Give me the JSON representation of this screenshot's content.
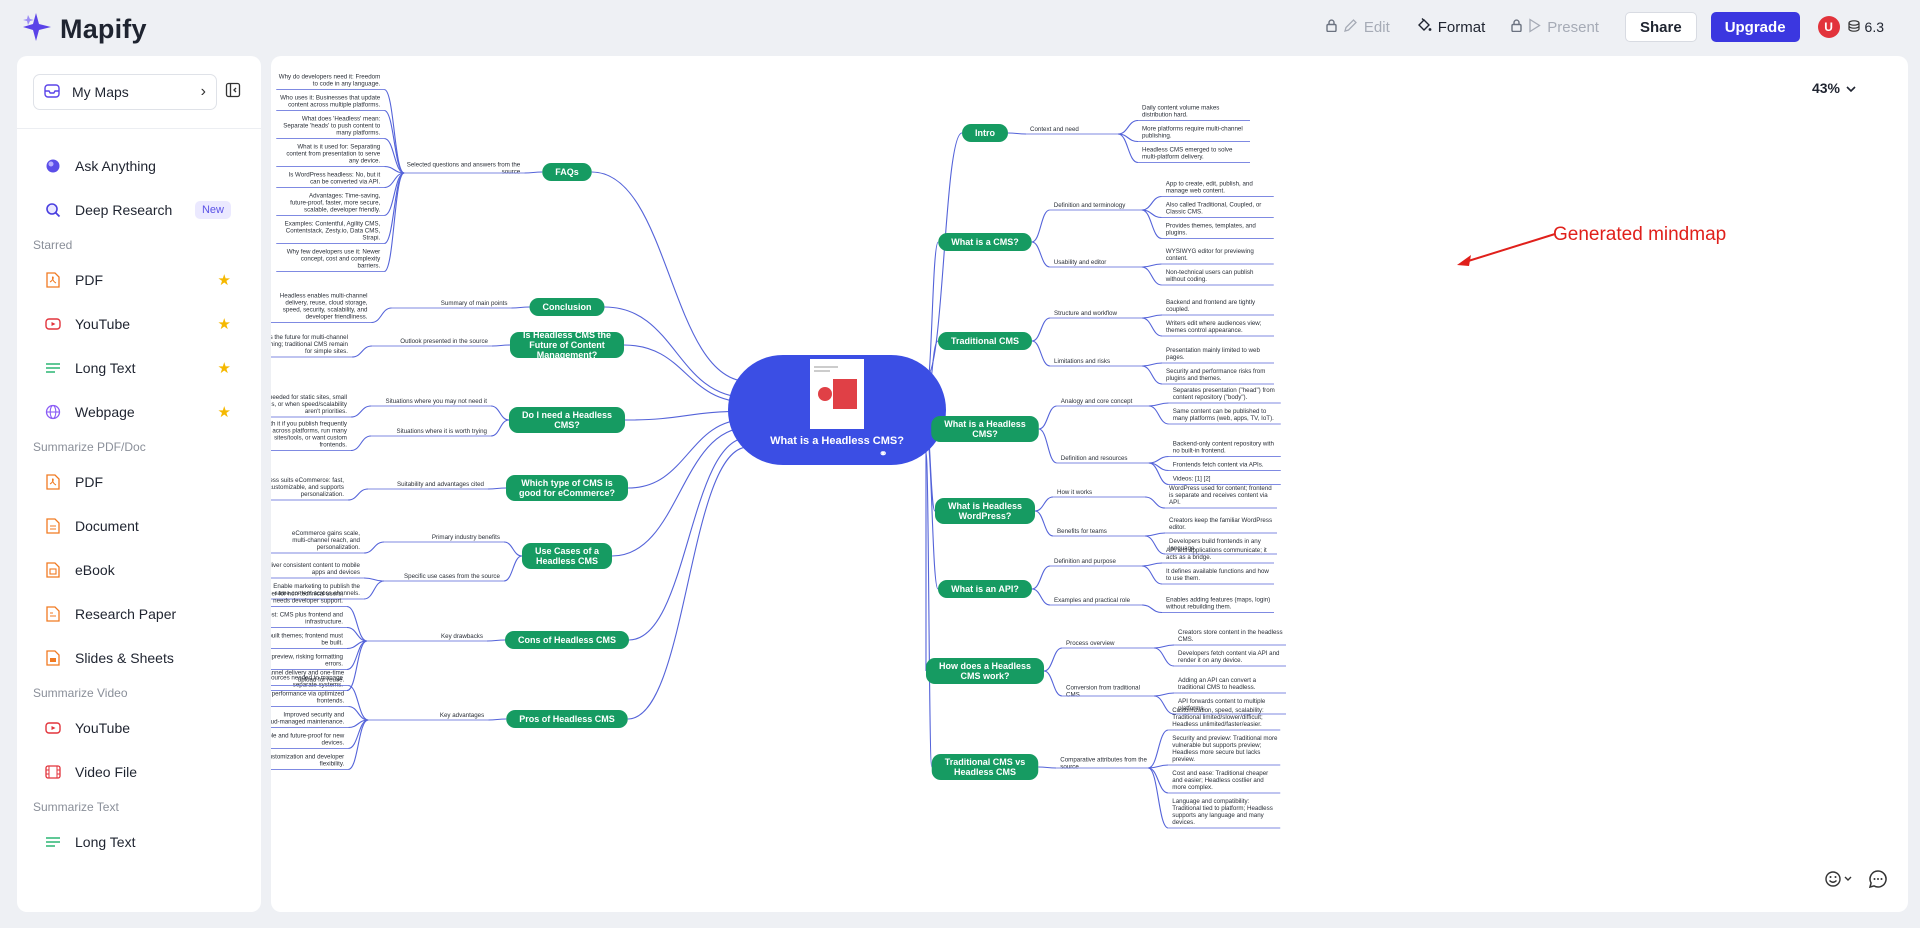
{
  "app": {
    "name": "Mapify"
  },
  "toolbar": {
    "edit": "Edit",
    "format": "Format",
    "present": "Present",
    "share": "Share",
    "upgrade": "Upgrade",
    "avatar": "U",
    "credits": "6.3"
  },
  "sidebar": {
    "my_maps": "My Maps",
    "items": [
      {
        "label": "Ask Anything",
        "icon": "orb-icon"
      },
      {
        "label": "Deep Research",
        "icon": "search-icon",
        "badge": "New"
      }
    ],
    "starred_head": "Starred",
    "starred": [
      {
        "label": "PDF",
        "icon": "pdf-icon"
      },
      {
        "label": "YouTube",
        "icon": "youtube-icon"
      },
      {
        "label": "Long Text",
        "icon": "long-text-icon"
      },
      {
        "label": "Webpage",
        "icon": "globe-icon"
      }
    ],
    "pdf_head": "Summarize PDF/Doc",
    "pdf": [
      {
        "label": "PDF",
        "icon": "pdf-icon"
      },
      {
        "label": "Document",
        "icon": "document-icon"
      },
      {
        "label": "eBook",
        "icon": "ebook-icon"
      },
      {
        "label": "Research Paper",
        "icon": "paper-icon"
      },
      {
        "label": "Slides & Sheets",
        "icon": "slides-icon"
      }
    ],
    "video_head": "Summarize Video",
    "video": [
      {
        "label": "YouTube",
        "icon": "youtube-icon"
      },
      {
        "label": "Video File",
        "icon": "video-file-icon"
      }
    ],
    "text_head": "Summarize Text",
    "text": [
      {
        "label": "Long Text",
        "icon": "long-text-icon"
      }
    ]
  },
  "canvas": {
    "zoom": "43%",
    "annotation": "Generated mindmap"
  },
  "mindmap": {
    "root": "What is a Headless CMS?",
    "left": [
      {
        "label": "FAQs",
        "children": [
          {
            "label": "Selected questions and answers from the source",
            "leaves": [
              "Why do developers need it: Freedom to code in any language.",
              "Who uses it: Businesses that update content across multiple platforms.",
              "What does 'Headless' mean: Separate 'heads' to push content to many platforms.",
              "What is it used for: Separating content from presentation to serve any device.",
              "Is WordPress headless: No, but it can be converted via API.",
              "Advantages: Time-saving, future-proof, faster, more secure, scalable, developer friendly.",
              "Examples: Contentful, Agility CMS, Contentstack, Zesty.io, Data CMS, Strapi.",
              "Why few developers use it: Newer concept, cost and complexity barriers."
            ]
          }
        ]
      },
      {
        "label": "Conclusion",
        "children": [
          {
            "label": "Summary of main points",
            "leaves": [
              "Headless enables multi-channel delivery, reuse, cloud storage, speed, security, scalability, and developer friendliness."
            ]
          }
        ]
      },
      {
        "label": "Is Headless CMS the Future of Content Management?",
        "children": [
          {
            "label": "Outlook presented in the source",
            "leaves": [
              "Seen as the future for multi-channel publishing; traditional CMS remain for simple sites."
            ]
          }
        ]
      },
      {
        "label": "Do I need a Headless CMS?",
        "children": [
          {
            "label": "Situations where you may not need it",
            "leaves": [
              "Not needed for static sites, small audiences, or when speed/scalability aren't priorities."
            ]
          },
          {
            "label": "Situations where it is worth trying",
            "leaves": [
              "Worth it if you publish frequently across platforms, run many sites/tools, or want custom frontends."
            ]
          }
        ]
      },
      {
        "label": "Which type of CMS is good for eCommerce?",
        "children": [
          {
            "label": "Suitability and advantages cited",
            "leaves": [
              "Headless suits eCommerce: fast, scalable, customizable, and supports personalization."
            ]
          }
        ]
      },
      {
        "label": "Use Cases of a Headless CMS",
        "children": [
          {
            "label": "Primary industry benefits",
            "leaves": [
              "eCommerce gains scale, multi-channel reach, and personalization."
            ]
          },
          {
            "label": "Specific use cases from the source",
            "leaves": [
              "Deliver consistent content to mobile apps and devices",
              "Enable marketing to publish the same content across channels."
            ]
          }
        ]
      },
      {
        "label": "Cons of Headless CMS",
        "children": [
          {
            "label": "Key drawbacks",
            "leaves": [
              "Harder for non-technical users; needs developer support.",
              "Higher cost: CMS plus frontend and infrastructure.",
              "No pre-built themes; frontend must be built.",
              "No editor preview, risking formatting errors.",
              "More resources needed to manage separate systems."
            ]
          }
        ]
      },
      {
        "label": "Pros of Headless CMS",
        "children": [
          {
            "label": "Key advantages",
            "leaves": [
              "Multi-channel delivery and one-time upload for reuse.",
              "Faster performance via optimized frontends.",
              "Improved security and cloud-managed maintenance.",
              "Scalable and future-proof for new devices.",
              "Greater customization and developer flexibility."
            ]
          }
        ]
      }
    ],
    "right": [
      {
        "label": "Intro",
        "children": [
          {
            "label": "Context and need",
            "leaves": [
              "Daily content volume makes distribution hard.",
              "More platforms require multi-channel publishing.",
              "Headless CMS emerged to solve multi-platform delivery."
            ]
          }
        ]
      },
      {
        "label": "What is a CMS?",
        "children": [
          {
            "label": "Definition and terminology",
            "leaves": [
              "App to create, edit, publish, and manage web content.",
              "Also called Traditional, Coupled, or Classic CMS.",
              "Provides themes, templates, and plugins."
            ]
          },
          {
            "label": "Usability and editor",
            "leaves": [
              "WYSIWYG editor for previewing content.",
              "Non-technical users can publish without coding."
            ]
          }
        ]
      },
      {
        "label": "Traditional CMS",
        "children": [
          {
            "label": "Structure and workflow",
            "leaves": [
              "Backend and frontend are tightly coupled.",
              "Writers edit where audiences view; themes control appearance."
            ]
          },
          {
            "label": "Limitations and risks",
            "leaves": [
              "Presentation mainly limited to web pages.",
              "Security and performance risks from plugins and themes."
            ]
          }
        ]
      },
      {
        "label": "What is a Headless CMS?",
        "children": [
          {
            "label": "Analogy and core concept",
            "leaves": [
              "Separates presentation (\"head\") from content repository (\"body\").",
              "Same content can be published to many platforms (web, apps, TV, IoT)."
            ]
          },
          {
            "label": "Definition and resources",
            "leaves": [
              "Backend-only content repository with no built-in frontend.",
              "Frontends fetch content via APIs.",
              "Videos: [1] [2]"
            ]
          }
        ]
      },
      {
        "label": "What is Headless WordPress?",
        "children": [
          {
            "label": "How it works",
            "leaves": [
              "WordPress used for content; frontend is separate and receives content via API."
            ]
          },
          {
            "label": "Benefits for teams",
            "leaves": [
              "Creators keep the familiar WordPress editor.",
              "Developers build frontends in any language."
            ]
          }
        ]
      },
      {
        "label": "What is an API?",
        "children": [
          {
            "label": "Definition and purpose",
            "leaves": [
              "API lets applications communicate; it acts as a bridge.",
              "It defines available functions and how to use them."
            ]
          },
          {
            "label": "Examples and practical role",
            "leaves": [
              "Enables adding features (maps, login) without rebuilding them."
            ]
          }
        ]
      },
      {
        "label": "How does a Headless CMS work?",
        "children": [
          {
            "label": "Process overview",
            "leaves": [
              "Creators store content in the headless CMS.",
              "Developers fetch content via API and render it on any device."
            ]
          },
          {
            "label": "Conversion from traditional CMS",
            "leaves": [
              "Adding an API can convert a traditional CMS to headless.",
              "API forwards content to multiple platforms."
            ]
          }
        ]
      },
      {
        "label": "Traditional CMS vs Headless CMS",
        "children": [
          {
            "label": "Comparative attributes from the source",
            "leaves": [
              "Customization, speed, scalability: Traditional limited/slower/difficult; Headless unlimited/faster/easier.",
              "Security and preview: Traditional more vulnerable but supports preview; Headless more secure but lacks preview.",
              "Cost and ease: Traditional cheaper and easier; Headless costlier and more complex.",
              "Language and compatibility: Traditional tied to platform; Headless supports any language and many devices."
            ]
          }
        ]
      }
    ]
  }
}
